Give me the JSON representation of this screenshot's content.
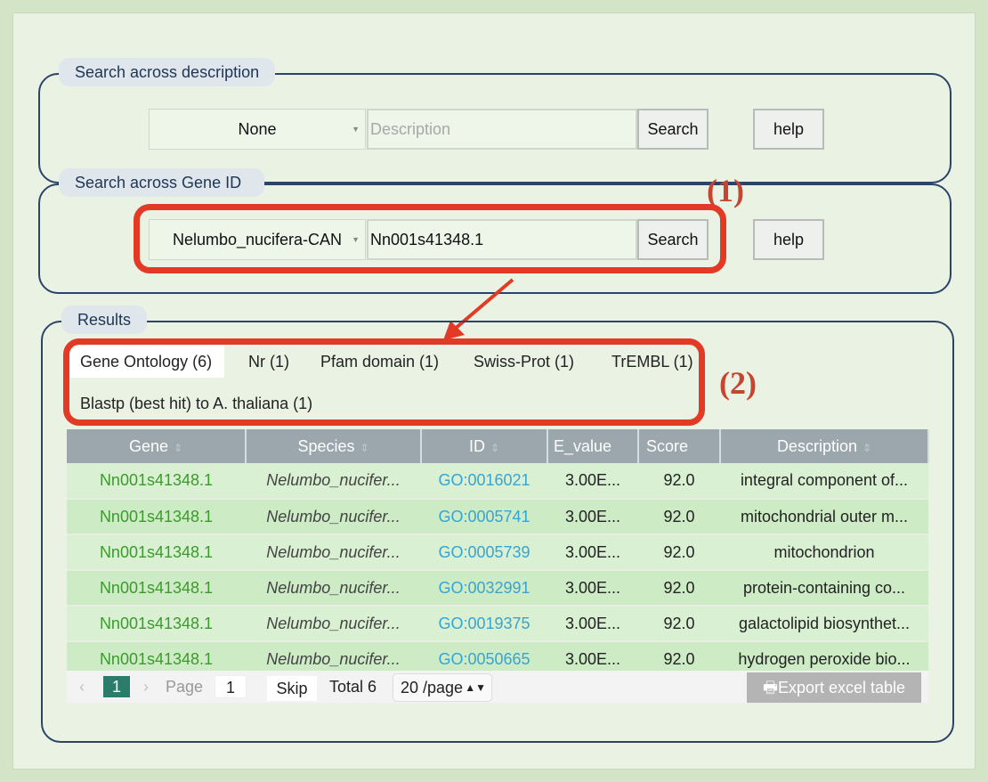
{
  "desc_search": {
    "legend": "Search across description",
    "select_value": "None",
    "input_placeholder": "Description",
    "search_label": "Search",
    "help_label": "help"
  },
  "gene_search": {
    "legend": "Search across Gene ID",
    "select_value": "Nelumbo_nucifera-CAN",
    "input_value": "Nn001s41348.1",
    "search_label": "Search",
    "help_label": "help"
  },
  "annotations": {
    "one": "(1)",
    "two": "(2)"
  },
  "results": {
    "legend": "Results",
    "tabs": [
      {
        "label": "Gene Ontology (6)",
        "active": true
      },
      {
        "label": "Nr (1)"
      },
      {
        "label": "Pfam domain (1)"
      },
      {
        "label": "Swiss-Prot (1)"
      },
      {
        "label": "TrEMBL (1)"
      },
      {
        "label": "Blastp (best hit) to A. thaliana (1)"
      }
    ],
    "columns": [
      "Gene",
      "Species",
      "ID",
      "E_value",
      "Score",
      "Description"
    ],
    "rows": [
      {
        "gene": "Nn001s41348.1",
        "species": "Nelumbo_nucifer...",
        "id": "GO:0016021",
        "evalue": "3.00E...",
        "score": "92.0",
        "description": "integral component of..."
      },
      {
        "gene": "Nn001s41348.1",
        "species": "Nelumbo_nucifer...",
        "id": "GO:0005741",
        "evalue": "3.00E...",
        "score": "92.0",
        "description": "mitochondrial outer m..."
      },
      {
        "gene": "Nn001s41348.1",
        "species": "Nelumbo_nucifer...",
        "id": "GO:0005739",
        "evalue": "3.00E...",
        "score": "92.0",
        "description": "mitochondrion"
      },
      {
        "gene": "Nn001s41348.1",
        "species": "Nelumbo_nucifer...",
        "id": "GO:0032991",
        "evalue": "3.00E...",
        "score": "92.0",
        "description": "protein-containing co..."
      },
      {
        "gene": "Nn001s41348.1",
        "species": "Nelumbo_nucifer...",
        "id": "GO:0019375",
        "evalue": "3.00E...",
        "score": "92.0",
        "description": "galactolipid biosynthet..."
      },
      {
        "gene": "Nn001s41348.1",
        "species": "Nelumbo_nucifer...",
        "id": "GO:0050665",
        "evalue": "3.00E...",
        "score": "92.0",
        "description": "hydrogen peroxide bio..."
      }
    ],
    "pager": {
      "prev": "‹",
      "current_page": "1",
      "next": "›",
      "page_label": "Page",
      "page_input": "1",
      "skip_label": "Skip",
      "total_label": "Total 6",
      "per_page": "20 /page",
      "export_label": "Export excel table"
    }
  },
  "colors": {
    "accent_red": "#e23a24",
    "frame_navy": "#2c4468",
    "gene_green": "#3c9a2d",
    "id_blue": "#35a4d6",
    "page_active": "#2b7c6a"
  }
}
